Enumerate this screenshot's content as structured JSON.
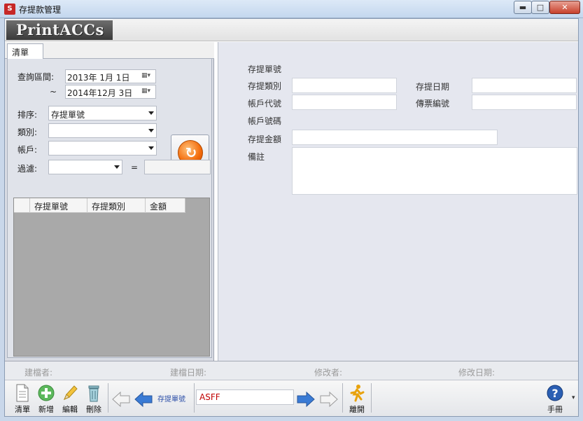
{
  "window": {
    "title": "存提款管理",
    "controls": {
      "minimize": "▬",
      "maximize": "□",
      "close": "✕"
    }
  },
  "brand": {
    "logo_text": "PrintACCs"
  },
  "left_panel": {
    "tab_label": "清單",
    "query_range_label": "查詢區間:",
    "range_separator": "~",
    "date_from": "2013年  1月  1日",
    "date_to": "2014年12月  3日",
    "sort_label": "排序:",
    "sort_value": "存提單號",
    "category_label": "類別:",
    "category_value": "",
    "account_label": "帳戶:",
    "account_value": "",
    "filter_label": "過濾:",
    "filter_value": "",
    "filter_equals": "=",
    "filter_text": "",
    "grid_columns": [
      "存提單號",
      "存提類別",
      "金額"
    ]
  },
  "right_panel": {
    "doc_no_label": "存提單號",
    "type_label": "存提類別",
    "date_label": "存提日期",
    "account_code_label": "帳戶代號",
    "voucher_no_label": "傳票編號",
    "account_no_label": "帳戶號碼",
    "amount_label": "存提金額",
    "note_label": "備註"
  },
  "status": {
    "creator_label": "建檔者:",
    "created_date_label": "建檔日期:",
    "modifier_label": "修改者:",
    "modified_date_label": "修改日期:"
  },
  "toolbar": {
    "list_label": "清單",
    "add_label": "新增",
    "edit_label": "編輯",
    "delete_label": "刪除",
    "nav_field_label": "存提單號",
    "nav_field_value": "ASFF",
    "exit_label": "離開",
    "manual_label": "手冊"
  },
  "colors": {
    "accent_blue": "#3a7bd5",
    "refresh_orange": "#f36b0a",
    "nav_value_red": "#c00000"
  }
}
